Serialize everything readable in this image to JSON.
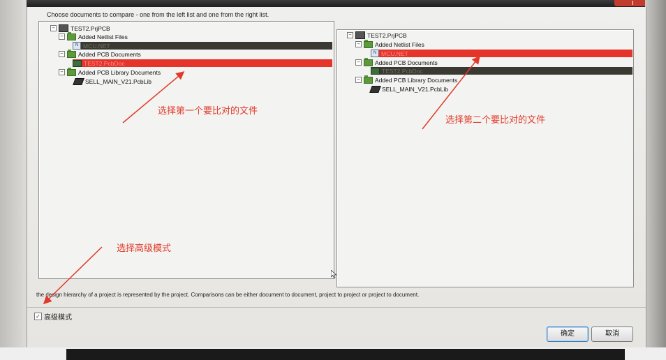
{
  "dialog": {
    "instruction": "Choose documents to compare - one from the left list and one from the right list.",
    "description": "the design hierarchy of a project is represented by the project. Comparisons can be either document to document, project to project or project to document.",
    "advanced_mode_label": "高级模式",
    "ok_label": "确定",
    "cancel_label": "取消"
  },
  "left_tree": {
    "project": "TEST2.PrjPCB",
    "netlist_folder": "Added Netlist Files",
    "netlist_item": "MCU.NET",
    "pcb_folder": "Added PCB Documents",
    "pcb_item": "TEST2.PcbDoc",
    "lib_folder": "Added PCB Library Documents",
    "lib_item": "SELL_MAIN_V21.PcbLib"
  },
  "right_tree": {
    "project": "TEST2.PrjPCB",
    "netlist_folder": "Added Netlist Files",
    "netlist_item": "MCU.NET",
    "pcb_folder": "Added PCB Documents",
    "pcb_item": "TEST2.PcbDoc",
    "lib_folder": "Added PCB Library Documents",
    "lib_item": "SELL_MAIN_V21.PcbLib"
  },
  "annotations": {
    "left": "选择第一个要比对的文件",
    "right": "选择第二个要比对的文件",
    "advanced": "选择高级模式"
  },
  "colors": {
    "highlight_red": "#e5352b",
    "annotation_red": "#e23a2a",
    "tree_dark": "#3a3a33"
  }
}
